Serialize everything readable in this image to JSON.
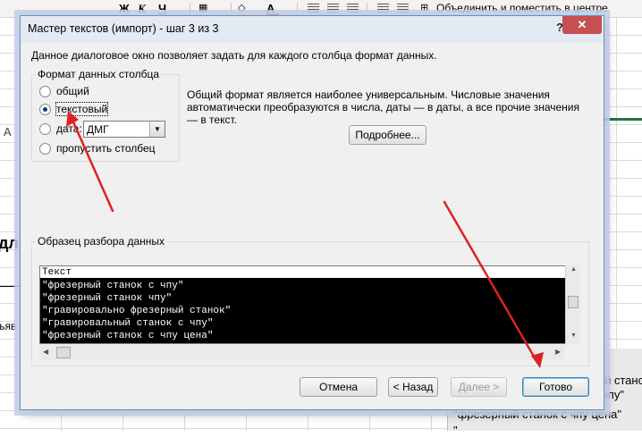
{
  "ribbon": {
    "bold_label": "Ж",
    "italic_label": "К",
    "underline_label": "Ч",
    "merge_label": "Объединить и поместить в центре",
    "font_color_letter": "А"
  },
  "sheet": {
    "column_a": "A",
    "fragment_dl": "дло",
    "fragment_ya": "ъяв",
    "cells_right": {
      "r1": "й станс",
      "r2": "чпу\"",
      "r3": "\"фрезерный станок с чпу цена\"",
      "r4": "\""
    }
  },
  "dialog": {
    "title": "Мастер текстов (импорт) - шаг 3 из 3",
    "help": "?",
    "close": "✕",
    "intro": "Данное диалоговое окно позволяет задать для каждого столбца формат данных.",
    "format_group": {
      "legend": "Формат данных столбца",
      "options": [
        {
          "label": "общий",
          "checked": false
        },
        {
          "label": "текстовый",
          "checked": true
        },
        {
          "label": "дата:",
          "checked": false
        },
        {
          "label": "пропустить столбец",
          "checked": false
        }
      ],
      "date_format": "ДМГ"
    },
    "description": "Общий формат является наиболее универсальным. Числовые значения автоматически преобразуются в числа, даты — в даты, а все прочие значения — в текст.",
    "more_button": "Подробнее...",
    "preview": {
      "legend": "Образец разбора данных",
      "header": "Текст",
      "rows": [
        "\"фрезерный станок с чпу\"",
        "\"фрезерный станок чпу\"",
        "\"гравировально фрезерный станок\"",
        "\"гравировальный станок с чпу\"",
        "\"фрезерный станок с чпу цена\""
      ]
    },
    "buttons": {
      "cancel": "Отмена",
      "back": "< Назад",
      "next": "Далее >",
      "finish": "Готово"
    }
  },
  "colors": {
    "arrow": "#e02020",
    "close_button": "#c75050",
    "excel_green": "#217346"
  }
}
